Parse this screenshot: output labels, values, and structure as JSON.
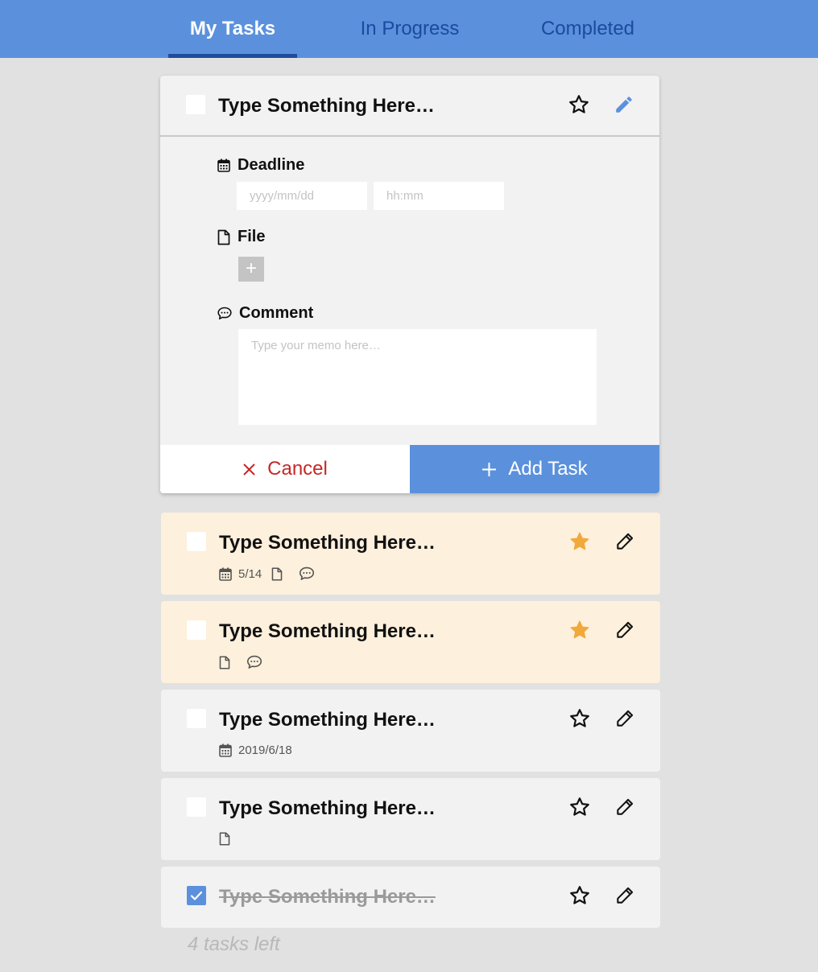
{
  "tabs": {
    "my_tasks": "My Tasks",
    "in_progress": "In Progress",
    "completed": "Completed"
  },
  "editor": {
    "title": "Type Something Here…",
    "deadline_label": "Deadline",
    "date_placeholder": "yyyy/mm/dd",
    "time_placeholder": "hh:mm",
    "file_label": "File",
    "add_file": "+",
    "comment_label": "Comment",
    "comment_placeholder": "Type your memo here…",
    "cancel_label": "Cancel",
    "add_task_label": "Add Task"
  },
  "tasks": [
    {
      "title": "Type Something Here…",
      "date": "5/14",
      "starred": true,
      "done": false
    },
    {
      "title": "Type Something Here…",
      "starred": true,
      "done": false
    },
    {
      "title": "Type Something Here…",
      "date": "2019/6/18",
      "starred": false,
      "done": false
    },
    {
      "title": "Type Something Here…",
      "starred": false,
      "done": false
    },
    {
      "title": "Type Something Here…",
      "starred": false,
      "done": true
    }
  ],
  "footer": {
    "tasks_left": "4 tasks left"
  },
  "colors": {
    "primary": "#5b91dc",
    "star_active": "#f0a93a",
    "important_bg": "#fdf0dc",
    "cancel": "#c62828"
  }
}
